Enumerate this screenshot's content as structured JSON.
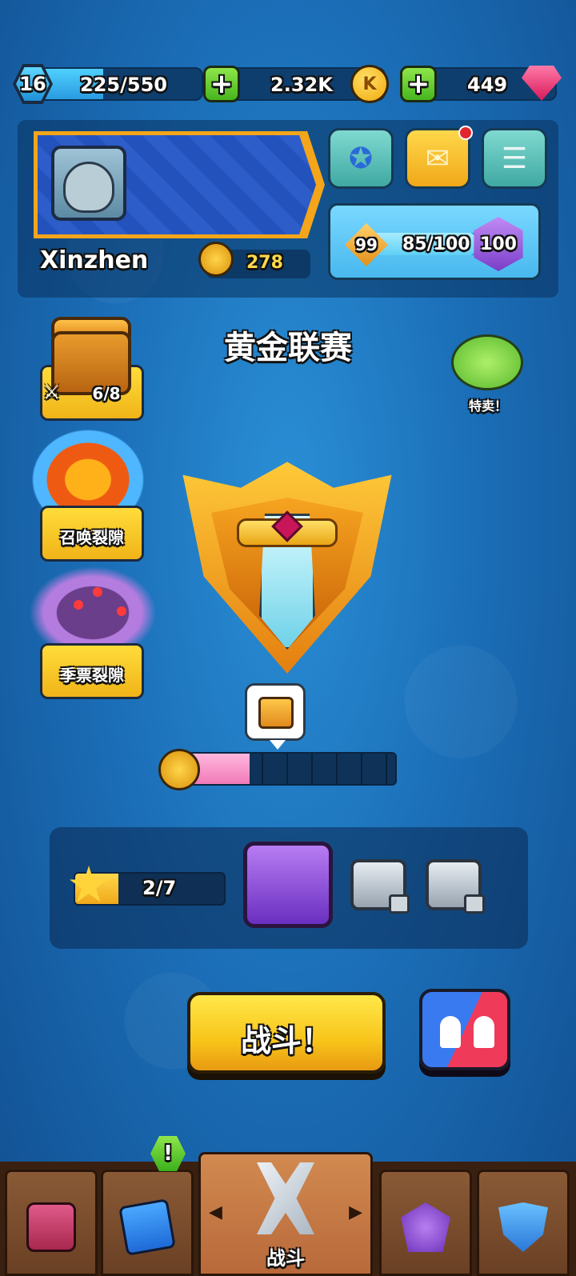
{
  "top_bar": {
    "level": "16",
    "xp": "225/550",
    "xp_progress": 0.41,
    "coins": "2.32K",
    "coin_symbol": "K",
    "gems": "449"
  },
  "profile": {
    "username": "Xinzhen",
    "trophies": "278",
    "pass_left": "99",
    "pass_progress_text": "85/100",
    "pass_progress": 0.85,
    "pass_right": "100"
  },
  "left_features": {
    "chest_counter": "6/8",
    "summon_rift": "召唤裂隙",
    "season_rift": "季票裂隙"
  },
  "league_title": "黄金联赛",
  "special_offer": "特卖！",
  "league_progress": 0.33,
  "chest_progress": {
    "stars": "2/7",
    "progress": 0.286
  },
  "battle_button": "战斗！",
  "bottom_nav": {
    "active_label": "战斗",
    "alert": "!"
  },
  "colors": {
    "background": "#1b6fb8",
    "accent_yellow": "#f8c51a",
    "accent_green": "#47b51e"
  },
  "icons": [
    "level-hex-icon",
    "plus-icon",
    "coin-icon",
    "gem-icon",
    "verified-badge-icon",
    "mail-icon",
    "menu-icon",
    "crown-badge-icon",
    "chest-icon",
    "crossed-swords-icon",
    "cards-icon",
    "star-badge-icon",
    "clan-shield-icon"
  ]
}
